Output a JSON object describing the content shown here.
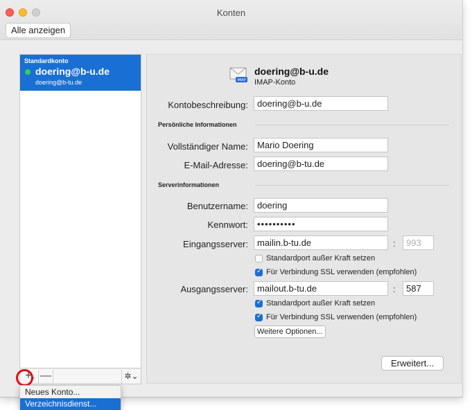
{
  "window": {
    "title": "Konten",
    "show_all": "Alle anzeigen"
  },
  "sidebar": {
    "selected_account": {
      "type": "Standardkonto",
      "name": "doering@b-u.de",
      "email": "doering@b-tu.de"
    },
    "add_label": "+",
    "remove_label": "—",
    "gear_label": "✲⌄"
  },
  "dropdown": {
    "items": [
      "Neues Konto...",
      "Verzeichnisdienst..."
    ],
    "selected": "Verzeichnisdienst..."
  },
  "detail": {
    "account_name": "doering@b-u.de",
    "account_kind": "IMAP-Konto",
    "description_label": "Kontobeschreibung:",
    "description_value": "doering@b-u.de",
    "personal_heading": "Persönliche Informationen",
    "fullname_label": "Vollständiger Name:",
    "fullname_value": "Mario Doering",
    "email_label": "E-Mail-Adresse:",
    "email_value": "doering@b-tu.de",
    "server_heading": "Serverinformationen",
    "username_label": "Benutzername:",
    "username_value": "doering",
    "password_label": "Kennwort:",
    "password_value": "••••••••••",
    "incoming_label": "Eingangsserver:",
    "incoming_value": "mailin.b-tu.de",
    "incoming_port": "993",
    "incoming_override_label": "Standardport außer Kraft setzen",
    "incoming_override_checked": false,
    "incoming_ssl_label": "Für Verbindung SSL verwenden (empfohlen)",
    "incoming_ssl_checked": true,
    "outgoing_label": "Ausgangsserver:",
    "outgoing_value": "mailout.b-tu.de",
    "outgoing_port": "587",
    "outgoing_override_label": "Standardport außer Kraft setzen",
    "outgoing_override_checked": true,
    "outgoing_ssl_label": "Für Verbindung SSL verwenden (empfohlen)",
    "outgoing_ssl_checked": true,
    "more_options": "Weitere Optionen...",
    "advanced": "Erweitert..."
  },
  "colors": {
    "accent": "#1a6fd4",
    "status_online": "#2fd15a",
    "highlight_ring": "#e30b13"
  },
  "icons": {
    "mail": "envelope-imap-icon",
    "gear": "gear-icon"
  }
}
